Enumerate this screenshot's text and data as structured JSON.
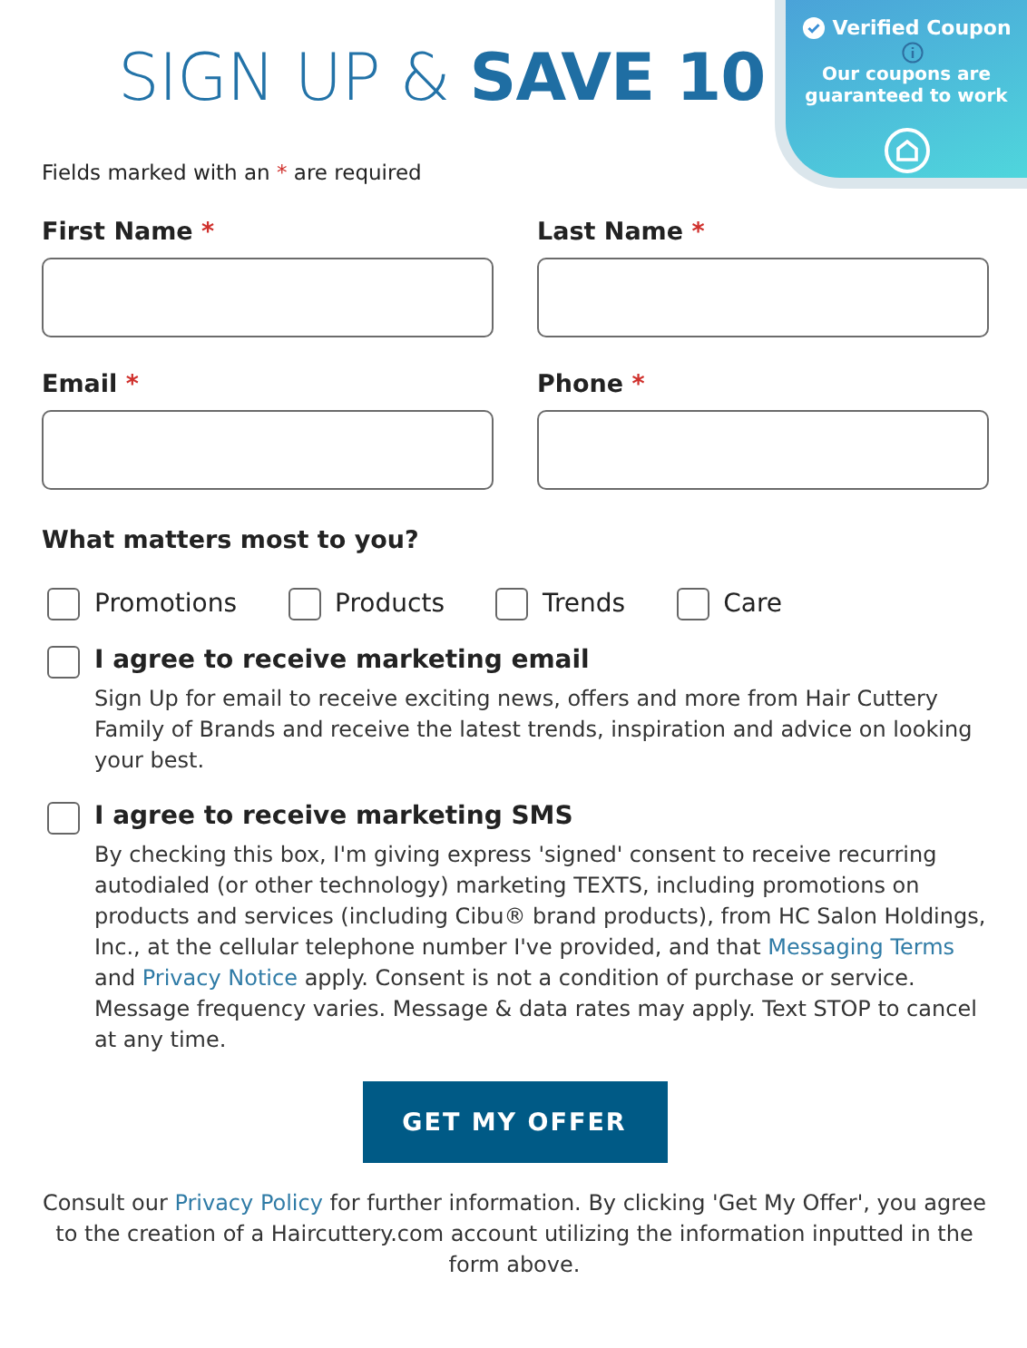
{
  "title": {
    "light": "SIGN UP &",
    "bold": "SAVE 10"
  },
  "coupon_badge": {
    "title": "Verified Coupon",
    "text": "Our coupons are guaranteed to work"
  },
  "required_note": {
    "before": "Fields marked with an",
    "mark": "*",
    "after": "are required"
  },
  "fields": [
    {
      "label": "First Name",
      "required": true
    },
    {
      "label": "Last Name",
      "required": true
    },
    {
      "label": "Email",
      "required": true
    },
    {
      "label": "Phone",
      "required": true
    }
  ],
  "interests": {
    "question": "What matters most to you?",
    "options": [
      {
        "label": "Promotions",
        "checked": false
      },
      {
        "label": "Products",
        "checked": false
      },
      {
        "label": "Trends",
        "checked": false
      },
      {
        "label": "Care",
        "checked": false
      }
    ]
  },
  "consents": [
    {
      "label": "I agree to receive marketing email",
      "checked": false,
      "description": [
        {
          "kind": "text",
          "text": "Sign Up for email to receive exciting news, offers and more from Hair Cuttery Family of Brands and receive the latest trends, inspiration and advice on looking your best."
        }
      ]
    },
    {
      "label": "I agree to receive marketing SMS",
      "checked": false,
      "description": [
        {
          "kind": "text",
          "text": "By checking this box, I'm giving express 'signed' consent to receive recurring autodialed (or other technology) marketing TEXTS, including promotions on products and services (including Cibu® brand products), from HC Salon Holdings, Inc., at the cellular telephone number I've provided, and that "
        },
        {
          "kind": "link",
          "text": "Messaging Terms"
        },
        {
          "kind": "text",
          "text": " and "
        },
        {
          "kind": "link",
          "text": "Privacy Notice"
        },
        {
          "kind": "text",
          "text": " apply. Consent is not a condition of purchase or service. Message frequency varies. Message & data rates may apply. Text STOP to cancel at any time."
        }
      ]
    }
  ],
  "submit": "GET MY OFFER",
  "footer": [
    {
      "kind": "text",
      "text": "Consult our "
    },
    {
      "kind": "link",
      "text": "Privacy Policy"
    },
    {
      "kind": "text",
      "text": " for further information. By clicking 'Get My Offer', you agree to the creation of a Haircuttery.com account utilizing the information inputted in the form above."
    }
  ]
}
